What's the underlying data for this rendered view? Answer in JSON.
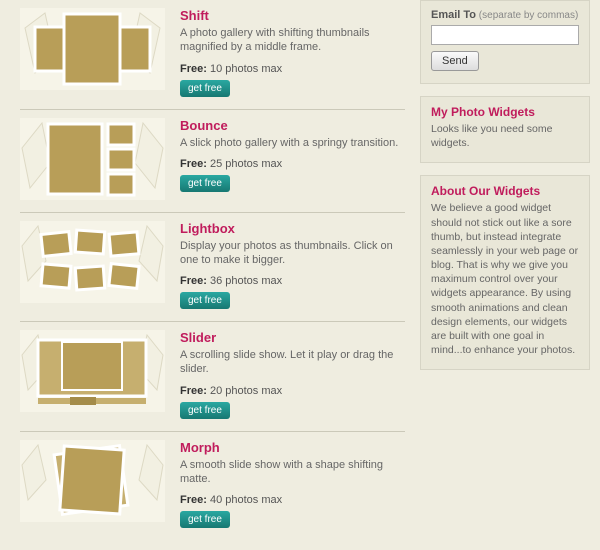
{
  "widgets": [
    {
      "title": "Shift",
      "desc": "A photo gallery with shifting thumbnails magnified by a middle frame.",
      "free_label": "Free:",
      "free_text": " 10 photos max",
      "button": "get free"
    },
    {
      "title": "Bounce",
      "desc": "A slick photo gallery with a springy transition.",
      "free_label": "Free:",
      "free_text": " 25 photos max",
      "button": "get free"
    },
    {
      "title": "Lightbox",
      "desc": "Display your photos as thumbnails. Click on one to make it bigger.",
      "free_label": "Free:",
      "free_text": " 36 photos max",
      "button": "get free"
    },
    {
      "title": "Slider",
      "desc": "A scrolling slide show. Let it play or drag the slider.",
      "free_label": "Free:",
      "free_text": " 20 photos max",
      "button": "get free"
    },
    {
      "title": "Morph",
      "desc": "A smooth slide show with a shape shifting matte.",
      "free_label": "Free:",
      "free_text": " 40 photos max",
      "button": "get free"
    }
  ],
  "sidebar": {
    "email": {
      "label": "Email To",
      "separator": "  (separate by commas)",
      "value": "",
      "send": "Send"
    },
    "myphoto": {
      "title": "My Photo Widgets",
      "text": "Looks like you need some widgets."
    },
    "about": {
      "title": "About Our Widgets",
      "text": "We believe a good widget should not stick out like a sore thumb, but instead integrate seamlessly in your web page or blog. That is why we give you maximum control over your widgets appearance. By using smooth animations and clean design elements, our widgets are built with one goal in mind...to enhance your photos."
    }
  }
}
